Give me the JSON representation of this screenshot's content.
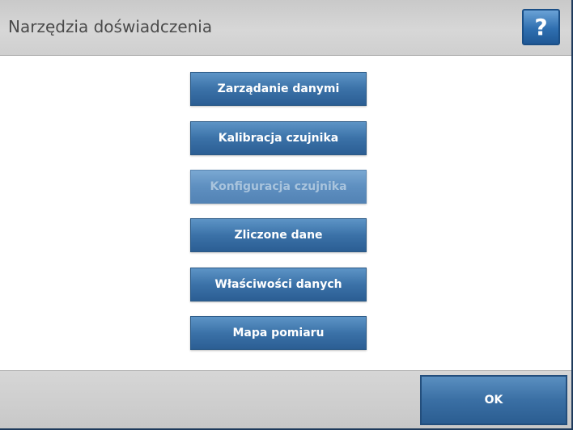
{
  "header": {
    "title": "Narzędzia doświadczenia",
    "help_label": "?"
  },
  "menu": {
    "items": [
      {
        "label": "Zarządanie danymi",
        "enabled": true
      },
      {
        "label": "Kalibracja czujnika",
        "enabled": true
      },
      {
        "label": "Konfiguracja czujnika",
        "enabled": false
      },
      {
        "label": "Zliczone dane",
        "enabled": true
      },
      {
        "label": "Właściwości danych",
        "enabled": true
      },
      {
        "label": "Mapa pomiaru",
        "enabled": true
      }
    ]
  },
  "footer": {
    "ok_label": "OK"
  },
  "colors": {
    "accent": "#3b72a8",
    "disabled_text": "#a9c4dd",
    "header_bg": "#d2d2d2"
  }
}
